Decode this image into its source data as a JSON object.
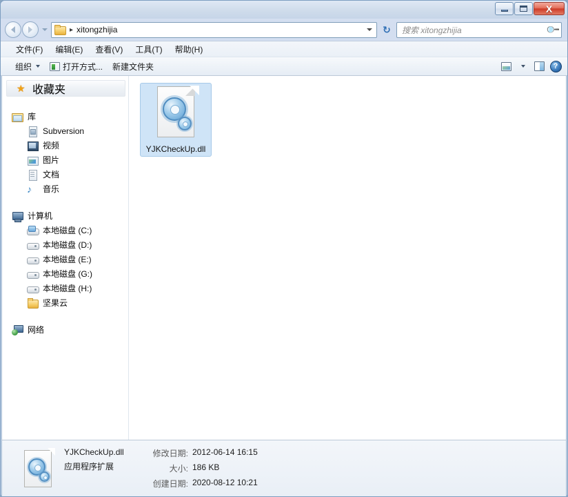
{
  "window": {
    "controls": {
      "minimize": "minimize",
      "maximize": "maximize",
      "close": "X"
    }
  },
  "address": {
    "back": "back",
    "forward": "forward",
    "history_caret": "history",
    "folder_icon": "folder-icon",
    "separator": "▸",
    "crumb": "xitongzhijia",
    "dropdown": "dropdown",
    "refresh": "↻"
  },
  "search": {
    "placeholder": "搜索 xitongzhijia",
    "icon": "search-icon"
  },
  "menubar": {
    "items": [
      {
        "label": "文件(F)"
      },
      {
        "label": "编辑(E)"
      },
      {
        "label": "查看(V)"
      },
      {
        "label": "工具(T)"
      },
      {
        "label": "帮助(H)"
      }
    ]
  },
  "toolbar": {
    "organize": "组织",
    "open_with": "打开方式...",
    "new_folder": "新建文件夹",
    "help_glyph": "?"
  },
  "sidebar": {
    "favorites": {
      "label": "收藏夹",
      "icon": "star-icon"
    },
    "groups": [
      {
        "root": {
          "label": "库",
          "icon": "library-icon"
        },
        "items": [
          {
            "label": "Subversion",
            "icon": "subversion-icon"
          },
          {
            "label": "视频",
            "icon": "video-icon"
          },
          {
            "label": "图片",
            "icon": "pictures-icon"
          },
          {
            "label": "文档",
            "icon": "documents-icon"
          },
          {
            "label": "音乐",
            "icon": "music-icon"
          }
        ]
      },
      {
        "root": {
          "label": "计算机",
          "icon": "computer-icon"
        },
        "items": [
          {
            "label": "本地磁盘 (C:)",
            "icon": "drive-system-icon"
          },
          {
            "label": "本地磁盘 (D:)",
            "icon": "drive-icon"
          },
          {
            "label": "本地磁盘 (E:)",
            "icon": "drive-icon"
          },
          {
            "label": "本地磁盘 (G:)",
            "icon": "drive-icon"
          },
          {
            "label": "本地磁盘 (H:)",
            "icon": "drive-icon"
          },
          {
            "label": "坚果云",
            "icon": "folder-icon"
          }
        ]
      },
      {
        "root": {
          "label": "网络",
          "icon": "network-icon"
        },
        "items": []
      }
    ]
  },
  "content": {
    "files": [
      {
        "name": "YJKCheckUp.dll",
        "icon": "dll-icon",
        "selected": true
      }
    ]
  },
  "statusbar": {
    "file_name": "YJKCheckUp.dll",
    "file_type": "应用程序扩展",
    "modified_key": "修改日期:",
    "modified_value": "2012-06-14 16:15",
    "size_key": "大小:",
    "size_value": "186 KB",
    "created_key": "创建日期:",
    "created_value": "2020-08-12 10:21"
  },
  "colors": {
    "title_bar": "#cfdceb",
    "close_button": "#cd3c28",
    "selection_fill": "#cfe4f7",
    "selection_border": "#a6c9e8",
    "accent_blue": "#2f6fb5"
  }
}
